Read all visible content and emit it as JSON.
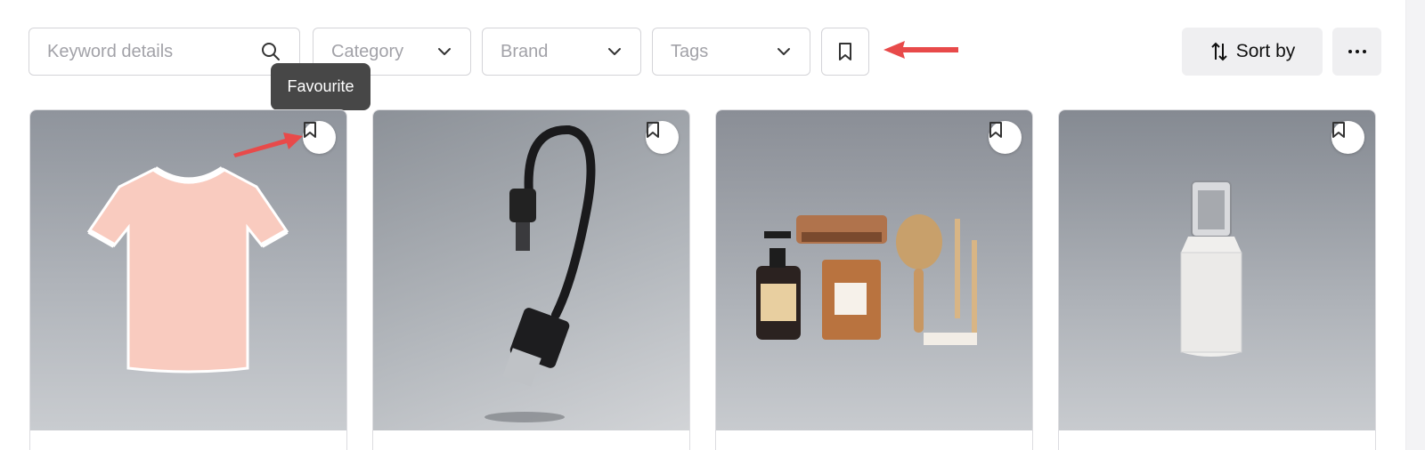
{
  "filters": {
    "keyword": {
      "placeholder": "Keyword details",
      "icon": "search-icon"
    },
    "category": {
      "label": "Category",
      "icon": "chevron-down-icon"
    },
    "brand": {
      "label": "Brand",
      "icon": "chevron-down-icon"
    },
    "tags": {
      "label": "Tags",
      "icon": "chevron-down-icon"
    },
    "favourite": {
      "icon": "bookmark-icon"
    }
  },
  "tooltip": {
    "text": "Favourite"
  },
  "toolbar": {
    "sort_label": "Sort by",
    "more_label": "···"
  },
  "products": [
    {
      "image": "pink-t-shirt",
      "bookmark_icon": "bookmark-icon"
    },
    {
      "image": "usb-cable",
      "bookmark_icon": "bookmark-icon"
    },
    {
      "image": "bathroom-toiletries-set",
      "bookmark_icon": "bookmark-icon"
    },
    {
      "image": "white-pump-bottle",
      "bookmark_icon": "bookmark-icon"
    }
  ],
  "colors": {
    "annotation_arrow": "#e84a4a",
    "tooltip_bg": "#474747",
    "button_bg": "#efeff1"
  }
}
